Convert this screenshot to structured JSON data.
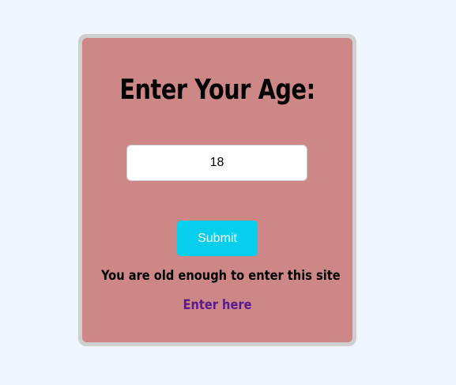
{
  "form": {
    "title": "Enter Your Age:",
    "age_value": "18",
    "submit_label": "Submit",
    "result_message": "You are old enough to enter this site",
    "enter_link_label": "Enter here"
  },
  "colors": {
    "page_background": "#eff6ff",
    "card_background": "#cd8787",
    "card_border": "#cfcfcf",
    "submit_button": "#05cfec",
    "link": "#5a1a8e"
  }
}
